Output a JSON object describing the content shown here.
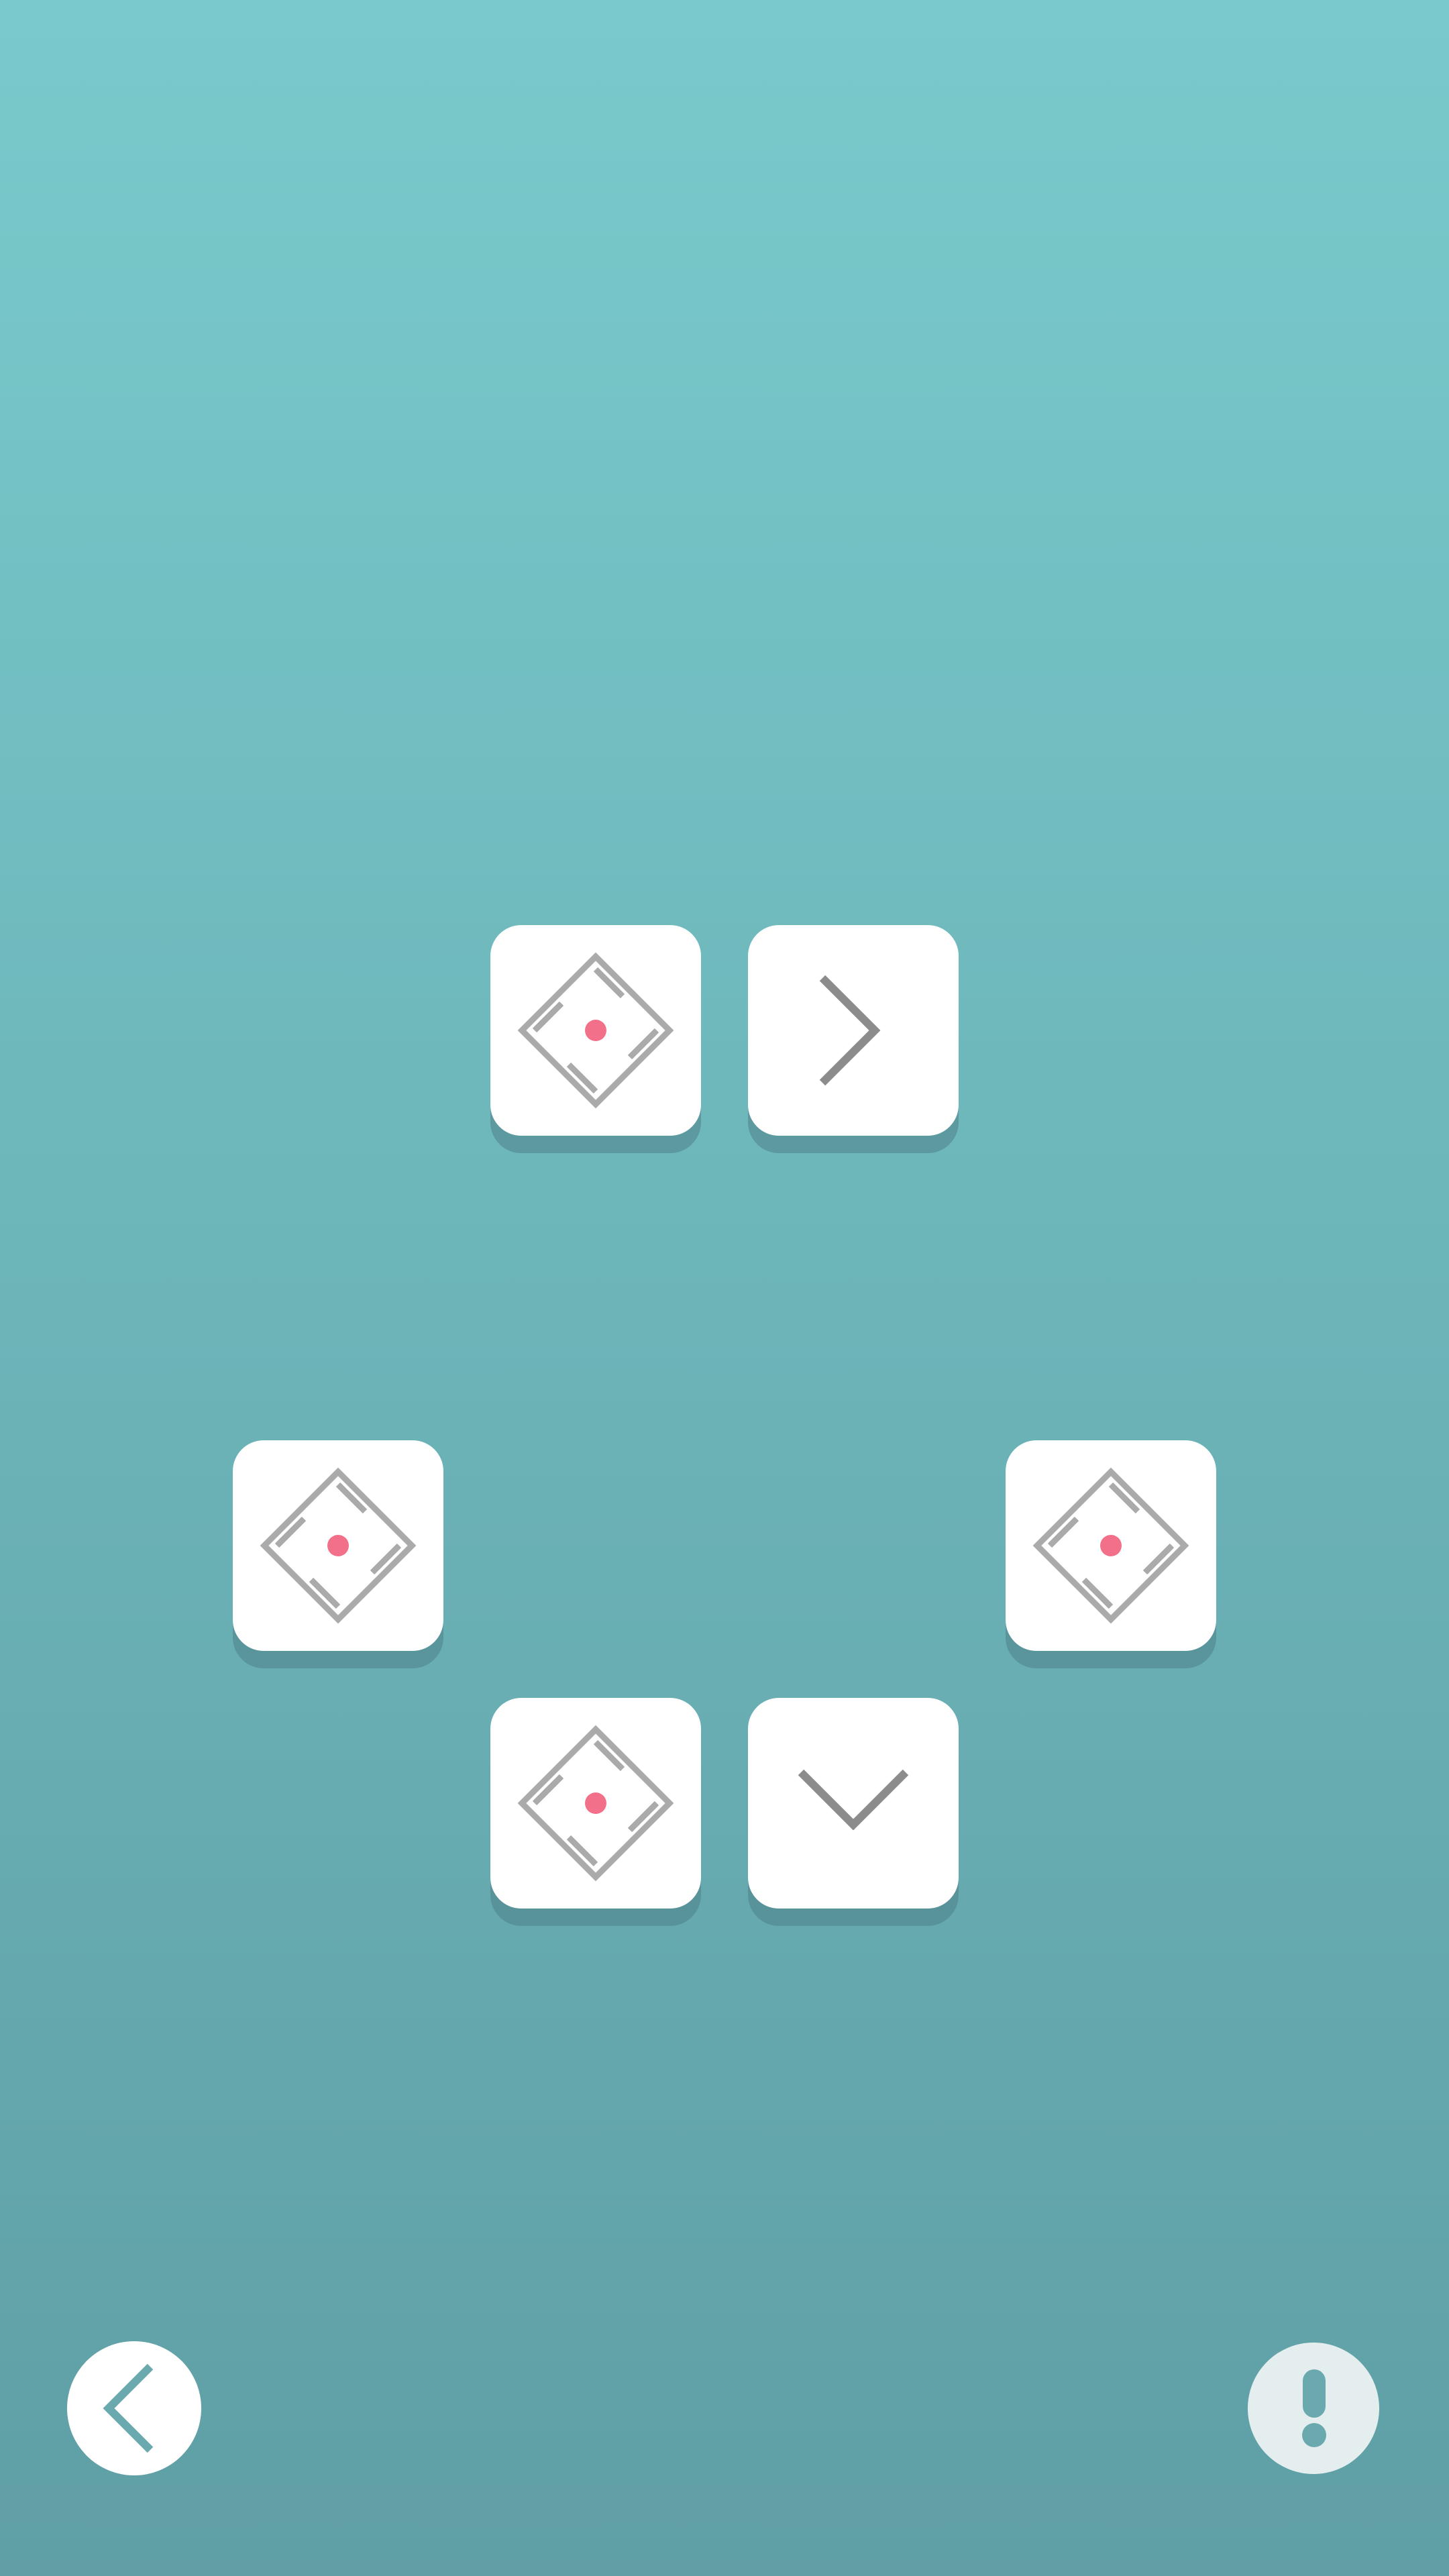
{
  "colors": {
    "background_top": "#79cacc",
    "background_bottom": "#5f9fa5",
    "tile": "#ffffff",
    "target_dot": "#f2708a",
    "wheel_stroke": "#aaaaaa",
    "arrow_stroke": "#8c8c8c",
    "icon_accent": "#6aa9ae"
  },
  "board": {
    "tiles": [
      {
        "id": "tile-1",
        "kind": "target-wheel",
        "icon": "target-wheel-icon",
        "row": 0,
        "col": 1
      },
      {
        "id": "tile-2",
        "kind": "arrow",
        "direction": "right",
        "icon": "chevron-right-icon",
        "row": 0,
        "col": 2
      },
      {
        "id": "tile-3",
        "kind": "target-wheel",
        "icon": "target-wheel-icon",
        "row": 2,
        "col": 0
      },
      {
        "id": "tile-4",
        "kind": "target-wheel",
        "icon": "target-wheel-icon",
        "row": 2,
        "col": 3
      },
      {
        "id": "tile-5",
        "kind": "target-wheel",
        "icon": "target-wheel-icon",
        "row": 3,
        "col": 1
      },
      {
        "id": "tile-6",
        "kind": "arrow",
        "direction": "down",
        "icon": "chevron-down-icon",
        "row": 3,
        "col": 2
      }
    ]
  },
  "controls": {
    "back": {
      "icon": "chevron-left-icon"
    },
    "hint": {
      "icon": "exclamation-icon"
    }
  }
}
